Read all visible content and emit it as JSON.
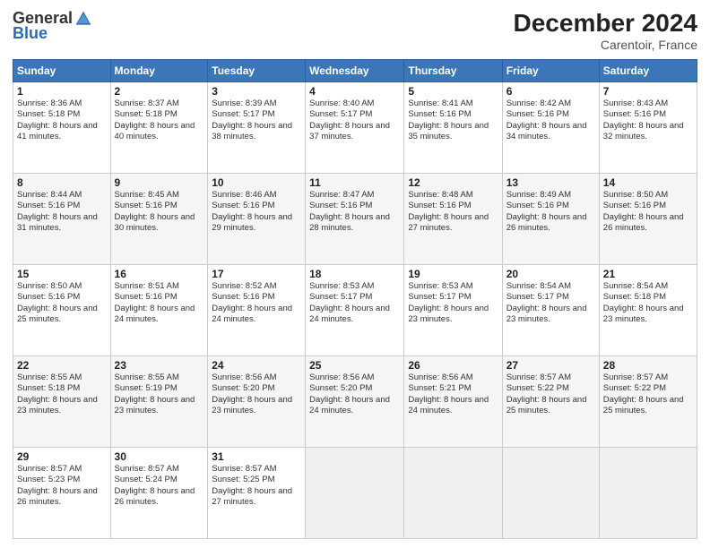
{
  "logo": {
    "general": "General",
    "blue": "Blue"
  },
  "header": {
    "month": "December 2024",
    "location": "Carentoir, France"
  },
  "weekdays": [
    "Sunday",
    "Monday",
    "Tuesday",
    "Wednesday",
    "Thursday",
    "Friday",
    "Saturday"
  ],
  "weeks": [
    [
      {
        "day": "1",
        "sunrise": "Sunrise: 8:36 AM",
        "sunset": "Sunset: 5:18 PM",
        "daylight": "Daylight: 8 hours and 41 minutes."
      },
      {
        "day": "2",
        "sunrise": "Sunrise: 8:37 AM",
        "sunset": "Sunset: 5:18 PM",
        "daylight": "Daylight: 8 hours and 40 minutes."
      },
      {
        "day": "3",
        "sunrise": "Sunrise: 8:39 AM",
        "sunset": "Sunset: 5:17 PM",
        "daylight": "Daylight: 8 hours and 38 minutes."
      },
      {
        "day": "4",
        "sunrise": "Sunrise: 8:40 AM",
        "sunset": "Sunset: 5:17 PM",
        "daylight": "Daylight: 8 hours and 37 minutes."
      },
      {
        "day": "5",
        "sunrise": "Sunrise: 8:41 AM",
        "sunset": "Sunset: 5:16 PM",
        "daylight": "Daylight: 8 hours and 35 minutes."
      },
      {
        "day": "6",
        "sunrise": "Sunrise: 8:42 AM",
        "sunset": "Sunset: 5:16 PM",
        "daylight": "Daylight: 8 hours and 34 minutes."
      },
      {
        "day": "7",
        "sunrise": "Sunrise: 8:43 AM",
        "sunset": "Sunset: 5:16 PM",
        "daylight": "Daylight: 8 hours and 32 minutes."
      }
    ],
    [
      {
        "day": "8",
        "sunrise": "Sunrise: 8:44 AM",
        "sunset": "Sunset: 5:16 PM",
        "daylight": "Daylight: 8 hours and 31 minutes."
      },
      {
        "day": "9",
        "sunrise": "Sunrise: 8:45 AM",
        "sunset": "Sunset: 5:16 PM",
        "daylight": "Daylight: 8 hours and 30 minutes."
      },
      {
        "day": "10",
        "sunrise": "Sunrise: 8:46 AM",
        "sunset": "Sunset: 5:16 PM",
        "daylight": "Daylight: 8 hours and 29 minutes."
      },
      {
        "day": "11",
        "sunrise": "Sunrise: 8:47 AM",
        "sunset": "Sunset: 5:16 PM",
        "daylight": "Daylight: 8 hours and 28 minutes."
      },
      {
        "day": "12",
        "sunrise": "Sunrise: 8:48 AM",
        "sunset": "Sunset: 5:16 PM",
        "daylight": "Daylight: 8 hours and 27 minutes."
      },
      {
        "day": "13",
        "sunrise": "Sunrise: 8:49 AM",
        "sunset": "Sunset: 5:16 PM",
        "daylight": "Daylight: 8 hours and 26 minutes."
      },
      {
        "day": "14",
        "sunrise": "Sunrise: 8:50 AM",
        "sunset": "Sunset: 5:16 PM",
        "daylight": "Daylight: 8 hours and 26 minutes."
      }
    ],
    [
      {
        "day": "15",
        "sunrise": "Sunrise: 8:50 AM",
        "sunset": "Sunset: 5:16 PM",
        "daylight": "Daylight: 8 hours and 25 minutes."
      },
      {
        "day": "16",
        "sunrise": "Sunrise: 8:51 AM",
        "sunset": "Sunset: 5:16 PM",
        "daylight": "Daylight: 8 hours and 24 minutes."
      },
      {
        "day": "17",
        "sunrise": "Sunrise: 8:52 AM",
        "sunset": "Sunset: 5:16 PM",
        "daylight": "Daylight: 8 hours and 24 minutes."
      },
      {
        "day": "18",
        "sunrise": "Sunrise: 8:53 AM",
        "sunset": "Sunset: 5:17 PM",
        "daylight": "Daylight: 8 hours and 24 minutes."
      },
      {
        "day": "19",
        "sunrise": "Sunrise: 8:53 AM",
        "sunset": "Sunset: 5:17 PM",
        "daylight": "Daylight: 8 hours and 23 minutes."
      },
      {
        "day": "20",
        "sunrise": "Sunrise: 8:54 AM",
        "sunset": "Sunset: 5:17 PM",
        "daylight": "Daylight: 8 hours and 23 minutes."
      },
      {
        "day": "21",
        "sunrise": "Sunrise: 8:54 AM",
        "sunset": "Sunset: 5:18 PM",
        "daylight": "Daylight: 8 hours and 23 minutes."
      }
    ],
    [
      {
        "day": "22",
        "sunrise": "Sunrise: 8:55 AM",
        "sunset": "Sunset: 5:18 PM",
        "daylight": "Daylight: 8 hours and 23 minutes."
      },
      {
        "day": "23",
        "sunrise": "Sunrise: 8:55 AM",
        "sunset": "Sunset: 5:19 PM",
        "daylight": "Daylight: 8 hours and 23 minutes."
      },
      {
        "day": "24",
        "sunrise": "Sunrise: 8:56 AM",
        "sunset": "Sunset: 5:20 PM",
        "daylight": "Daylight: 8 hours and 23 minutes."
      },
      {
        "day": "25",
        "sunrise": "Sunrise: 8:56 AM",
        "sunset": "Sunset: 5:20 PM",
        "daylight": "Daylight: 8 hours and 24 minutes."
      },
      {
        "day": "26",
        "sunrise": "Sunrise: 8:56 AM",
        "sunset": "Sunset: 5:21 PM",
        "daylight": "Daylight: 8 hours and 24 minutes."
      },
      {
        "day": "27",
        "sunrise": "Sunrise: 8:57 AM",
        "sunset": "Sunset: 5:22 PM",
        "daylight": "Daylight: 8 hours and 25 minutes."
      },
      {
        "day": "28",
        "sunrise": "Sunrise: 8:57 AM",
        "sunset": "Sunset: 5:22 PM",
        "daylight": "Daylight: 8 hours and 25 minutes."
      }
    ],
    [
      {
        "day": "29",
        "sunrise": "Sunrise: 8:57 AM",
        "sunset": "Sunset: 5:23 PM",
        "daylight": "Daylight: 8 hours and 26 minutes."
      },
      {
        "day": "30",
        "sunrise": "Sunrise: 8:57 AM",
        "sunset": "Sunset: 5:24 PM",
        "daylight": "Daylight: 8 hours and 26 minutes."
      },
      {
        "day": "31",
        "sunrise": "Sunrise: 8:57 AM",
        "sunset": "Sunset: 5:25 PM",
        "daylight": "Daylight: 8 hours and 27 minutes."
      },
      null,
      null,
      null,
      null
    ]
  ]
}
